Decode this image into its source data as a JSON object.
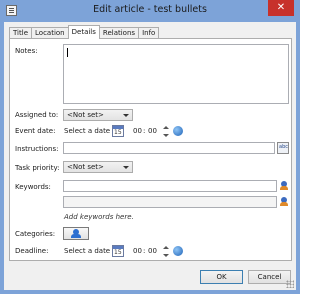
{
  "window": {
    "title": "Edit article - test bullets",
    "close_glyph": "✕"
  },
  "tabs": [
    {
      "label": "Title",
      "active": false
    },
    {
      "label": "Location",
      "active": false
    },
    {
      "label": "Details",
      "active": true
    },
    {
      "label": "Relations",
      "active": false
    },
    {
      "label": "Info",
      "active": false
    }
  ],
  "details": {
    "notes_label": "Notes:",
    "notes_value": "",
    "assigned_label": "Assigned to:",
    "assigned_value": "<Not set>",
    "event_date_label": "Event date:",
    "event_date_placeholder": "Select a date",
    "calendar_day": "15",
    "event_hours": "00",
    "event_minutes": "00",
    "time_separator": ":",
    "instructions_label": "Instructions:",
    "instructions_value": "",
    "spell_glyph": "abc",
    "priority_label": "Task priority:",
    "priority_value": "<Not set>",
    "keywords_label": "Keywords:",
    "keywords_value": "",
    "keywords_hint": "Add keywords here.",
    "categories_label": "Categories:",
    "deadline_label": "Deadline:",
    "deadline_placeholder": "Select a date",
    "deadline_hours": "00",
    "deadline_minutes": "00"
  },
  "buttons": {
    "ok": "OK",
    "cancel": "Cancel"
  },
  "colors": {
    "titlebar": "#7da3d8",
    "close": "#c7312b",
    "dialog_bg": "#f0f0f0"
  }
}
